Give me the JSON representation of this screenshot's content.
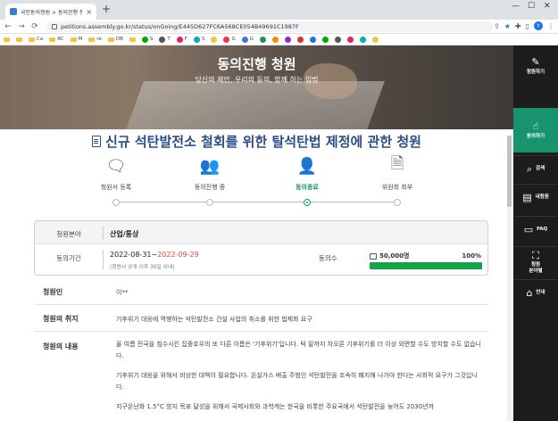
{
  "browser": {
    "tab_title": "국민동의청원 > 동의진행 청원",
    "tab_close": "×",
    "new_tab": "+",
    "url": "petitions.assembly.go.kr/status/onGoing/E445D627FC6A568CE054B49691C1987F",
    "avatar_letter": "Y",
    "bookmarks": [
      "",
      "",
      "Ca",
      "RC",
      "M",
      "re",
      "DB",
      "",
      "S",
      "T",
      "F",
      "S",
      "",
      "G",
      "G",
      "",
      "",
      "",
      "",
      "",
      "",
      "",
      "",
      "",
      ""
    ]
  },
  "hero": {
    "title": "동의진행 청원",
    "subtitle": "당신의 제안, 우리의 동의, 함께 하는 입법"
  },
  "sidebar": {
    "items": [
      {
        "label": "청원하기"
      },
      {
        "label": "동의하기"
      },
      {
        "label": "검색"
      },
      {
        "label": "내청원"
      },
      {
        "label": "FAQ"
      },
      {
        "label": "청원\n분야별"
      },
      {
        "label": "안내"
      }
    ]
  },
  "petition": {
    "title": "신규 석탄발전소 철회를 위한 탈석탄법 제정에 관한 청원"
  },
  "steps": [
    {
      "label": "청원서 등록",
      "active": false
    },
    {
      "label": "동의진행 중",
      "active": false
    },
    {
      "label": "동의종료",
      "active": true
    },
    {
      "label": "위원회 회부",
      "active": false
    }
  ],
  "info": {
    "field_label": "청원분야",
    "field_value": "산업/통상",
    "period_label": "동의기간",
    "period_start": "2022-08-31~",
    "period_end": "2022-09-29",
    "period_note": "(청원서 공개 이후 30일 이내)",
    "agree_label": "동의수",
    "agree_count": "50,000명",
    "agree_percent": "100%",
    "progress": 1.0
  },
  "details": {
    "petitioner_label": "청원인",
    "petitioner_value": "이**",
    "purpose_label": "청원의 취지",
    "purpose_value": "기후위기 대응에 역행하는 석탄발전소 건설 사업의 취소를 위한 법제화 요구",
    "content_label": "청원의 내용",
    "content_p1": "올 여름 전국을 침수시킨 집중호우의 또 다른 이름은 '기후위기'입니다. 턱 밑까지 차오른 기후위기를 더 이상 외면할 수도 방치할 수도 없습니다.",
    "content_p2": "기후위기 대응을 위해서 비상한 대책이 필요합니다. 온실가스 배출 주범인 석탄발전을 조속히 폐지해 나가야 한다는 사회적 요구가 그것입니다.",
    "content_p3": "지구온난화 1.5°C 방지 목표 달성을 위해서 국제사회와 과학계는 한국을 비롯한 주요국에서 석탄발전을 늦어도 2030년까"
  }
}
